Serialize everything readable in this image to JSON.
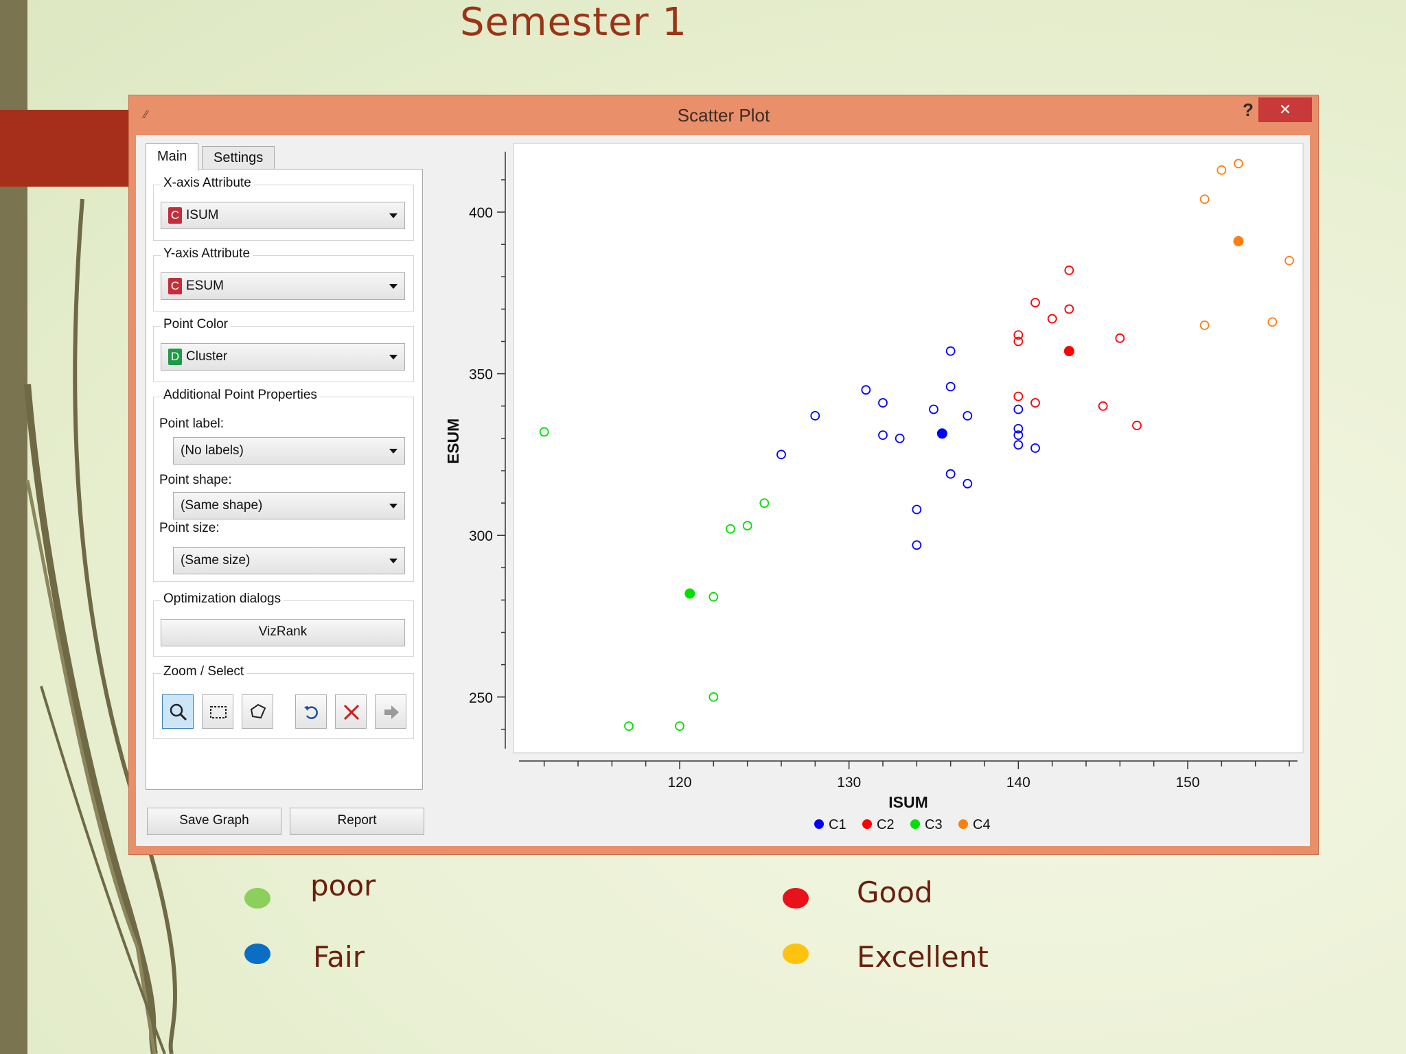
{
  "slide": {
    "title": "Semester 1",
    "legend": [
      {
        "label": "poor",
        "color": "#8ccf5a"
      },
      {
        "label": "Good",
        "color": "#e8121a"
      },
      {
        "label": "Fair",
        "color": "#0a6fc4"
      },
      {
        "label": "Excellent",
        "color": "#ffc20e"
      }
    ]
  },
  "window": {
    "title": "Scatter Plot",
    "help_label": "?",
    "close_label": "✕"
  },
  "tabs": {
    "main": "Main",
    "settings": "Settings"
  },
  "controls": {
    "x_axis": {
      "group_label": "X-axis Attribute",
      "badge": "C",
      "value": "ISUM"
    },
    "y_axis": {
      "group_label": "Y-axis Attribute",
      "badge": "C",
      "value": "ESUM"
    },
    "point_color": {
      "group_label": "Point Color",
      "badge": "D",
      "value": "Cluster"
    },
    "additional": {
      "group_label": "Additional Point Properties",
      "point_label_label": "Point label:",
      "point_label_value": "(No labels)",
      "point_shape_label": "Point shape:",
      "point_shape_value": "(Same shape)",
      "point_size_label": "Point size:",
      "point_size_value": "(Same size)"
    },
    "optimization": {
      "group_label": "Optimization dialogs",
      "vizrank_label": "VizRank"
    },
    "zoom": {
      "group_label": "Zoom / Select",
      "tools": [
        "zoom-icon",
        "rectangle-select-icon",
        "lasso-select-icon",
        "undo-icon",
        "remove-selection-icon",
        "send-data-icon"
      ]
    },
    "save_graph_label": "Save Graph",
    "report_label": "Report"
  },
  "chart_data": {
    "type": "scatter",
    "xlabel": "ISUM",
    "ylabel": "ESUM",
    "xlim": [
      111,
      156
    ],
    "ylim": [
      237,
      417
    ],
    "xticks": [
      120,
      130,
      140,
      150
    ],
    "yticks": [
      250,
      300,
      350,
      400
    ],
    "colors": {
      "C1": "#0000ff",
      "C2": "#ff0000",
      "C3": "#00e000",
      "C4": "#ff7f0e"
    },
    "series": [
      {
        "name": "C1",
        "color": "#0000ff",
        "points": [
          [
            126,
            325
          ],
          [
            128,
            337
          ],
          [
            131,
            345
          ],
          [
            132,
            341
          ],
          [
            132,
            331
          ],
          [
            133,
            330
          ],
          [
            134,
            308
          ],
          [
            134,
            297
          ],
          [
            135,
            339
          ],
          [
            136,
            346
          ],
          [
            136,
            357
          ],
          [
            136,
            319
          ],
          [
            137,
            337
          ],
          [
            137,
            316
          ],
          [
            140,
            339
          ],
          [
            140,
            333
          ],
          [
            140,
            331
          ],
          [
            140,
            328
          ],
          [
            141,
            327
          ]
        ],
        "filled": [
          [
            135.5,
            331.5
          ]
        ]
      },
      {
        "name": "C2",
        "color": "#ff0000",
        "points": [
          [
            140,
            362
          ],
          [
            140,
            360
          ],
          [
            140,
            343
          ],
          [
            141,
            372
          ],
          [
            141,
            341
          ],
          [
            142,
            367
          ],
          [
            143,
            382
          ],
          [
            143,
            370
          ],
          [
            145,
            340
          ],
          [
            146,
            361
          ],
          [
            147,
            334
          ]
        ],
        "filled": [
          [
            143,
            357
          ]
        ]
      },
      {
        "name": "C3",
        "color": "#00e000",
        "points": [
          [
            112,
            332
          ],
          [
            117,
            241
          ],
          [
            120,
            241
          ],
          [
            122,
            281
          ],
          [
            122,
            250
          ],
          [
            123,
            302
          ],
          [
            124,
            303
          ],
          [
            125,
            310
          ]
        ],
        "filled": [
          [
            120.6,
            282
          ]
        ]
      },
      {
        "name": "C4",
        "color": "#ff7f0e",
        "points": [
          [
            151,
            404
          ],
          [
            151,
            365
          ],
          [
            152,
            413
          ],
          [
            153,
            415
          ],
          [
            155,
            366
          ],
          [
            156,
            385
          ]
        ],
        "filled": [
          [
            153,
            391
          ]
        ]
      }
    ]
  }
}
